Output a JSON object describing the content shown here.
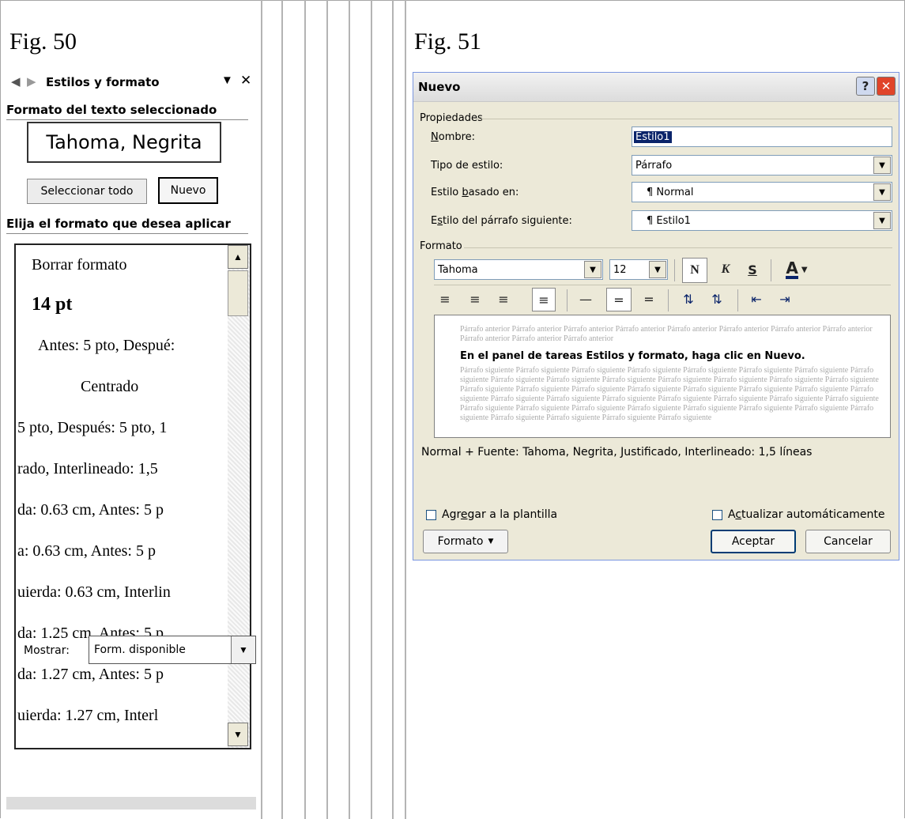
{
  "fig50": {
    "caption": "Fig. 50",
    "pane": {
      "title": "Estilos y formato",
      "selected_header": "Formato del texto seleccionado",
      "selected_value": "Tahoma, Negrita",
      "select_all": "Seleccionar todo",
      "new": "Nuevo",
      "apply_header": "Elija el formato que desea aplicar",
      "items": [
        "Borrar formato",
        "14 pt",
        "Antes:  5 pto, Despué:",
        "Centrado",
        "5 pto, Después:  5 pto, 1",
        "rado, Interlineado:  1,5",
        "da:  0.63 cm, Antes:  5 p",
        "a:  0.63 cm, Antes:  5 p",
        "uierda:  0.63 cm, Interlin",
        "da:  1.25 cm, Antes:  5 p",
        "da:  1.27 cm, Antes:  5 p",
        "uierda:  1.27 cm, Interl"
      ],
      "show_label": "Mostrar:",
      "show_value": "Form. disponible"
    }
  },
  "fig51": {
    "caption": "Fig. 51",
    "dialog": {
      "title": "Nuevo",
      "props_group": "Propiedades",
      "name_label": "Nombre:",
      "name_value": "Estilo1",
      "type_label": "Tipo de estilo:",
      "type_value": "Párrafo",
      "based_label": "Estilo basado en:",
      "based_value": "¶ Normal",
      "next_label": "Estilo del párrafo siguiente:",
      "next_value": "¶ Estilo1",
      "format_group": "Formato",
      "font": "Tahoma",
      "size": "12",
      "bold": "N",
      "italic": "K",
      "underline": "S",
      "color": "A",
      "preview_before": "Párrafo anterior Párrafo anterior Párrafo anterior Párrafo anterior Párrafo anterior Párrafo anterior Párrafo anterior Párrafo anterior Párrafo anterior Párrafo anterior Párrafo anterior",
      "preview_main": "En el panel de tareas Estilos y formato, haga clic en Nuevo.",
      "preview_after": "Párrafo siguiente Párrafo siguiente Párrafo siguiente Párrafo siguiente Párrafo siguiente Párrafo siguiente Párrafo siguiente Párrafo siguiente Párrafo siguiente Párrafo siguiente Párrafo siguiente Párrafo siguiente Párrafo siguiente Párrafo siguiente Párrafo siguiente Párrafo siguiente Párrafo siguiente Párrafo siguiente Párrafo siguiente Párrafo siguiente Párrafo siguiente Párrafo siguiente Párrafo siguiente Párrafo siguiente Párrafo siguiente Párrafo siguiente Párrafo siguiente Párrafo siguiente Párrafo siguiente Párrafo siguiente Párrafo siguiente Párrafo siguiente Párrafo siguiente Párrafo siguiente Párrafo siguiente Párrafo siguiente Párrafo siguiente Párrafo siguiente Párrafo siguiente Párrafo siguiente Párrafo siguiente Párrafo siguiente",
      "description": "Normal + Fuente: Tahoma, Negrita, Justificado, Interlineado:  1,5 líneas",
      "add_template": "Agregar a la plantilla",
      "auto_update": "Actualizar automáticamente",
      "format_button": "Formato",
      "ok": "Aceptar",
      "cancel": "Cancelar"
    }
  },
  "colors": {
    "close_red": "#e0442a",
    "help_blue": "#cfd9ef",
    "accent_blue": "#0a246a"
  }
}
